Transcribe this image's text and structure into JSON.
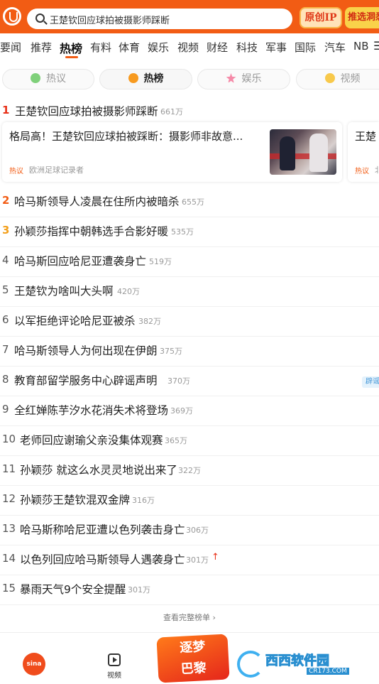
{
  "search": {
    "query": "王楚钦回应球拍被摄影师踩断",
    "promo_primary": "原创IP",
    "promo_secondary": "推选洞悉"
  },
  "categories": [
    "要闻",
    "推荐",
    "热榜",
    "有料",
    "体育",
    "娱乐",
    "视频",
    "财经",
    "科技",
    "军事",
    "国际",
    "汽车",
    "NB"
  ],
  "categories_active": "热榜",
  "subtabs": [
    {
      "label": "热议",
      "icon": "chat-icon",
      "active": false
    },
    {
      "label": "热榜",
      "icon": "fire-icon",
      "active": true
    },
    {
      "label": "娱乐",
      "icon": "star-icon",
      "active": false
    },
    {
      "label": "视频",
      "icon": "video-icon",
      "active": false
    }
  ],
  "top_item": {
    "rank": "1",
    "title": "王楚钦回应球拍被摄影师踩断",
    "count": "661万"
  },
  "cards": [
    {
      "title": "格局高！王楚钦回应球拍被踩断：摄影师非故意...",
      "tag": "热议",
      "source": "欧洲足球记录者"
    },
    {
      "title": "王楚",
      "tag": "热议",
      "source": "北"
    }
  ],
  "items": [
    {
      "rank": "2",
      "title": "哈马斯领导人凌晨在住所内被暗杀",
      "count": "655万"
    },
    {
      "rank": "3",
      "title": "孙颖莎指挥中朝韩选手合影好暖",
      "count": "535万"
    },
    {
      "rank": "4",
      "title": "哈马斯回应哈尼亚遭袭身亡",
      "count": "519万"
    },
    {
      "rank": "5",
      "title": "王楚钦为啥叫大头啊",
      "count": "420万"
    },
    {
      "rank": "6",
      "title": "以军拒绝评论哈尼亚被杀",
      "count": "382万"
    },
    {
      "rank": "7",
      "title": "哈马斯领导人为何出现在伊朗",
      "count": "375万"
    },
    {
      "rank": "8",
      "title": "教育部留学服务中心辟谣声明",
      "count": "370万"
    },
    {
      "rank": "9",
      "title": "全红婵陈芋汐水花消失术将登场",
      "count": "369万"
    },
    {
      "rank": "10",
      "title": "老师回应谢瑜父亲没集体观赛",
      "count": "365万"
    },
    {
      "rank": "11",
      "title": "孙颖莎 就这么水灵灵地说出来了",
      "count": "322万"
    },
    {
      "rank": "12",
      "title": "孙颖莎王楚钦混双金牌",
      "count": "316万"
    },
    {
      "rank": "13",
      "title": "哈马斯称哈尼亚遭以色列袭击身亡",
      "count": "306万"
    },
    {
      "rank": "14",
      "title": "以色列回应哈马斯领导人遇袭身亡",
      "count": "301万"
    },
    {
      "rank": "15",
      "title": "暴雨天气9个安全提醒",
      "count": "301万"
    }
  ],
  "side_badge": "辟谣",
  "view_full_list": "查看完整榜单 ›",
  "bottom": {
    "home_label": "sina",
    "video_label": "视频",
    "center_line1": "逐梦",
    "center_line2": "巴黎",
    "watermark_main": "西西软件园",
    "watermark_sub": "CR173.COM"
  },
  "colors": {
    "brand": "#f25c14",
    "rank1": "#e8321a",
    "rank3": "#f3a01c"
  }
}
